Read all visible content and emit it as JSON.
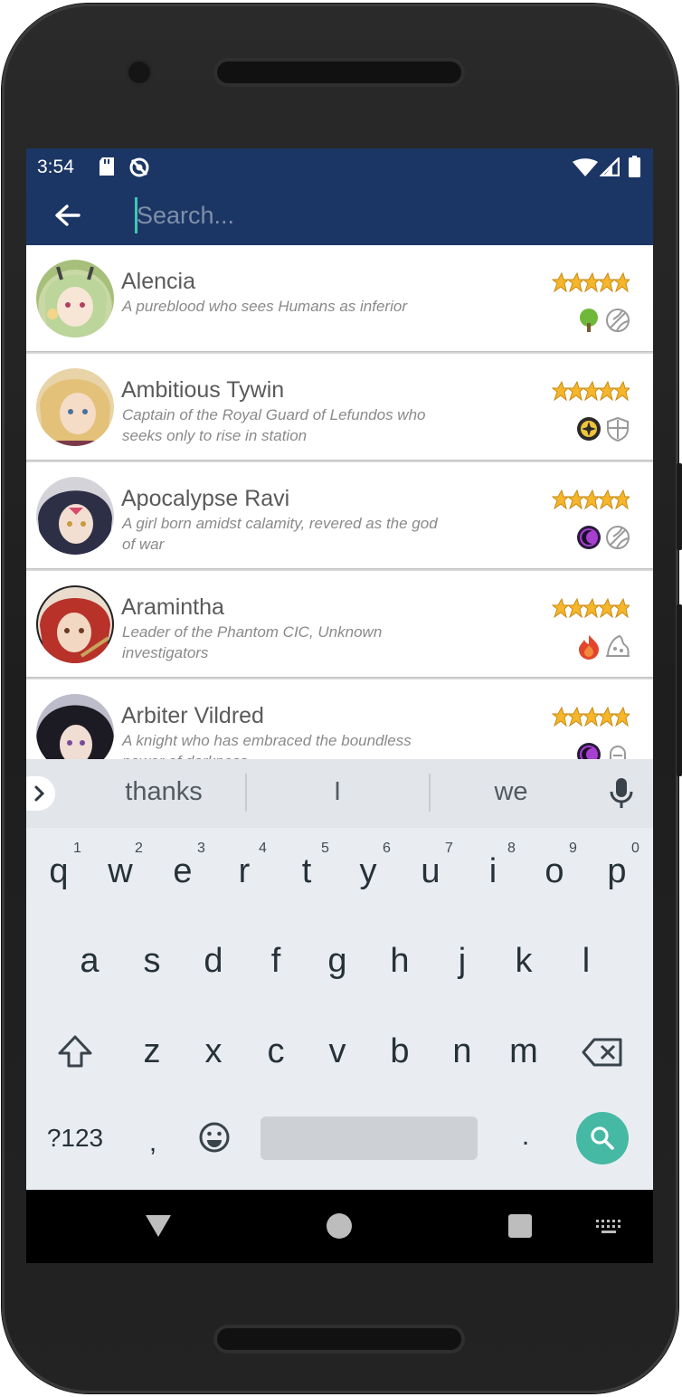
{
  "status_bar": {
    "time": "3:54"
  },
  "search": {
    "placeholder": "Search...",
    "value": ""
  },
  "heroes": [
    {
      "name": "Alencia",
      "description": "A pureblood who sees Humans as inferior",
      "stars": 5,
      "element": "earth",
      "class": "ranger"
    },
    {
      "name": "Ambitious Tywin",
      "description": "Captain of the Royal Guard of Lefundos who seeks only to rise in station",
      "stars": 5,
      "element": "light",
      "class": "knight"
    },
    {
      "name": "Apocalypse Ravi",
      "description": "A girl born amidst calamity, revered as the god of war",
      "stars": 5,
      "element": "dark",
      "class": "ranger"
    },
    {
      "name": "Aramintha",
      "description": "Leader of the Phantom CIC, Unknown investigators",
      "stars": 5,
      "element": "fire",
      "class": "mage"
    },
    {
      "name": "Arbiter Vildred",
      "description": "A knight who has embraced the boundless power of darkness",
      "stars": 5,
      "element": "dark",
      "class": "thief"
    }
  ],
  "keyboard": {
    "suggestions": [
      "thanks",
      "I",
      "we"
    ],
    "row1": [
      "q",
      "w",
      "e",
      "r",
      "t",
      "y",
      "u",
      "i",
      "o",
      "p"
    ],
    "row1_numbers": [
      "1",
      "2",
      "3",
      "4",
      "5",
      "6",
      "7",
      "8",
      "9",
      "0"
    ],
    "row2": [
      "a",
      "s",
      "d",
      "f",
      "g",
      "h",
      "j",
      "k",
      "l"
    ],
    "row3": [
      "z",
      "x",
      "c",
      "v",
      "b",
      "n",
      "m"
    ],
    "symbols_key": "?123",
    "comma_key": ",",
    "period_key": "."
  },
  "colors": {
    "app_bar": "#1b3664",
    "accent": "#46b9a4",
    "star": "#f5b62b"
  }
}
